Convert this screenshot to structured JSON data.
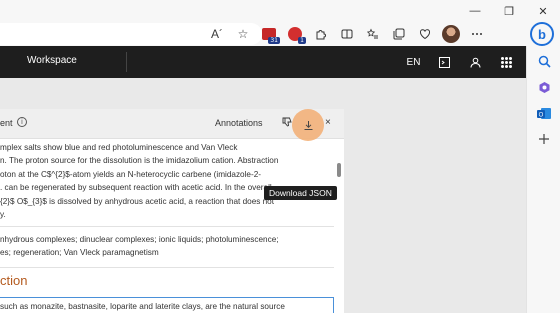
{
  "browser": {
    "toolbar_icons": [
      {
        "name": "read-aloud-icon",
        "glyph": "A´"
      },
      {
        "name": "favorite-star-icon",
        "glyph": "☆"
      }
    ],
    "ext_badges": {
      "first": "31",
      "second": "1"
    },
    "window_controls": {
      "minimize": "—",
      "maximize": "❐",
      "close": "✕"
    },
    "bing_label": "b"
  },
  "app": {
    "header": {
      "workspace_label": "Workspace",
      "language": "EN"
    },
    "panel": {
      "title": "ent",
      "info_glyph": "i",
      "annotations_label": "Annotations",
      "close_glyph": "×",
      "tooltip": "Download JSON",
      "abstract_lines": [
        "mplex salts show blue and red photoluminescence and Van Vleck",
        "n. The proton source for the dissolution is the imidazolium cation. Abstraction",
        "oton at the C$^{2}$-atom yields an N-heterocyclic carbene (imidazole-2-",
        ". can be regenerated by subsequent reaction with acetic acid. In the overall",
        "{2}$ O$_{3}$ is dissolved by anhydrous acetic acid, a reaction that does not",
        "y."
      ],
      "keywords_lines": [
        "nhydrous complexes; dinuclear complexes; ionic liquids; photoluminescence;",
        "es; regeneration; Van Vleck paramagnetism"
      ],
      "section_heading": "ction",
      "intro_text": "such as monazite, bastnasite, loparite and laterite clays, are the natural source"
    }
  },
  "colors": {
    "header_bg": "#1e1e1e",
    "heading_accent": "#b45a1e",
    "highlight_circle": "#f3b27a",
    "focus_border": "#4a90d9"
  }
}
